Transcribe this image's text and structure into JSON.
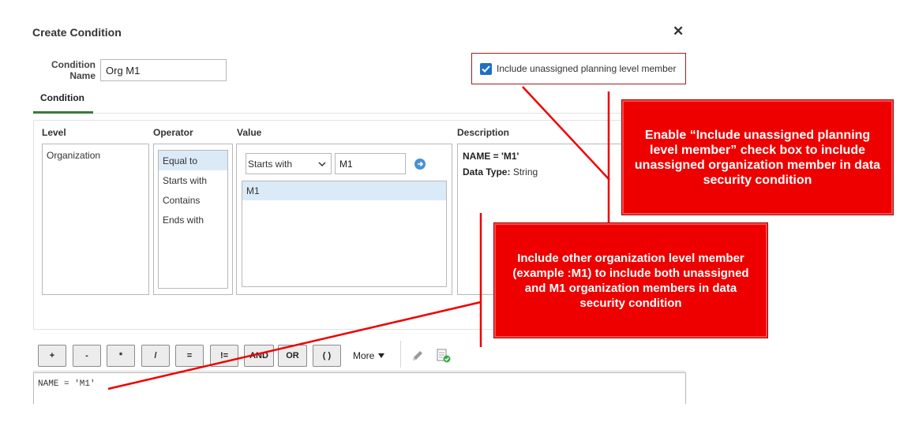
{
  "dialog": {
    "title": "Create Condition",
    "close_symbol": "✕"
  },
  "condition_name": {
    "label_line1": "Condition",
    "label_line2": "Name",
    "value": "Org M1"
  },
  "include_unassigned": {
    "label": "Include unassigned planning level member",
    "checked": true
  },
  "tabs": [
    {
      "label": "Condition",
      "selected": true
    }
  ],
  "columns": {
    "level": "Level",
    "operator": "Operator",
    "value": "Value",
    "description": "Description"
  },
  "level_list": [
    "Organization"
  ],
  "operator_list": [
    {
      "label": "Equal to",
      "selected": true
    },
    {
      "label": "Starts with",
      "selected": false
    },
    {
      "label": "Contains",
      "selected": false
    },
    {
      "label": "Ends with",
      "selected": false
    }
  ],
  "value_panel": {
    "match_select": "Starts with",
    "search_value": "M1",
    "results": [
      "M1"
    ]
  },
  "description": {
    "expression": "NAME = 'M1'",
    "data_type_label": "Data Type:",
    "data_type_value": "String"
  },
  "toolbar": {
    "buttons": [
      "+",
      "-",
      "*",
      "/",
      "=",
      "!=",
      "AND",
      "OR",
      "( )"
    ],
    "more_label": "More"
  },
  "expression_text": "NAME = 'M1'",
  "callouts": {
    "enable_checkbox": "Enable “Include unassigned planning level member” check box to include unassigned organization member in data security condition",
    "include_other": "Include other organization level member (example :M1) to include both unassigned and M1 organization members in data security condition"
  },
  "colors": {
    "callout_red": "#ee0000",
    "selection_blue": "#dbeaf7",
    "checkbox_blue": "#1f6fc5",
    "tab_underline_green": "#3a7a3a"
  }
}
